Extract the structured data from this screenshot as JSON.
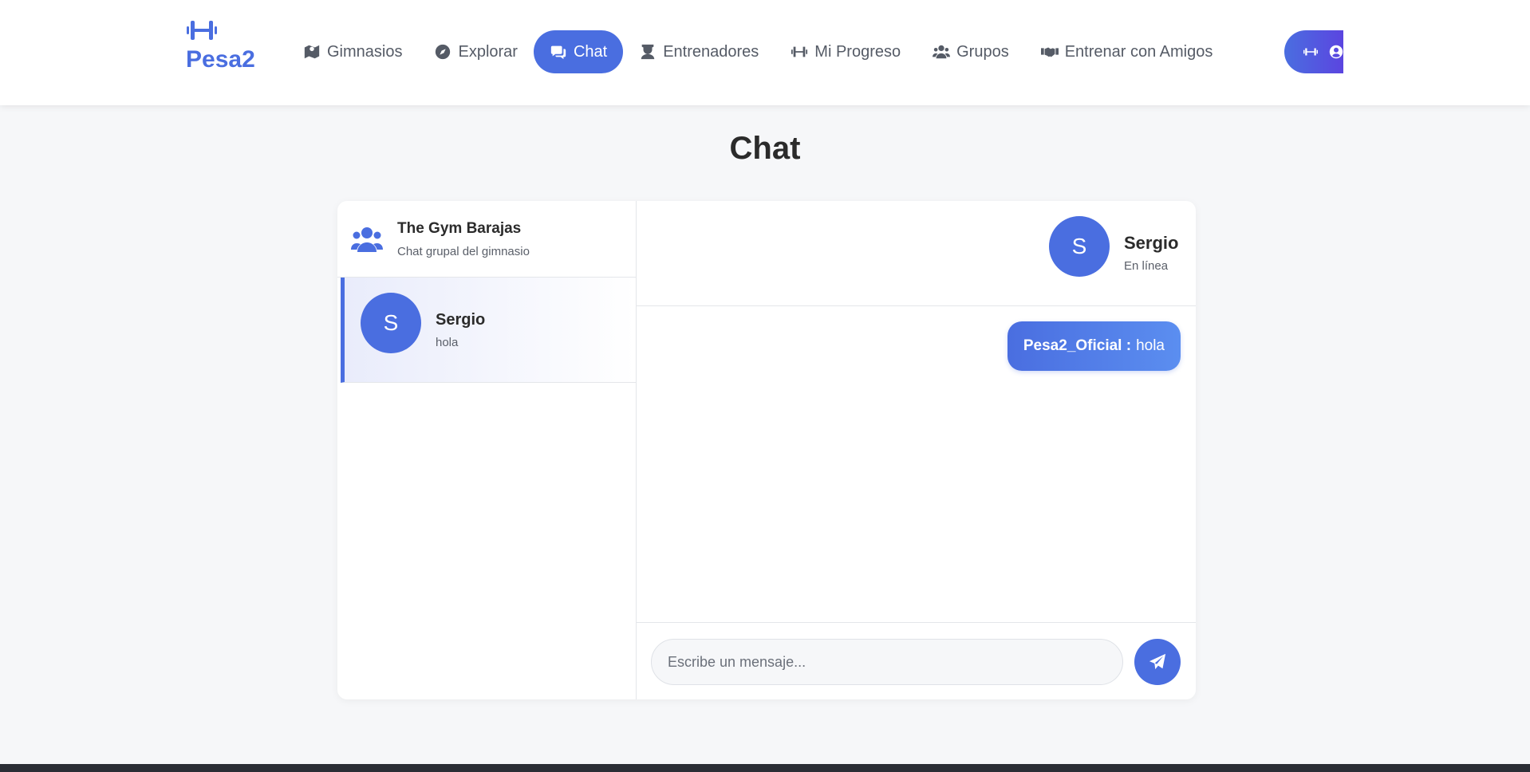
{
  "brand": {
    "name": "Pesa2",
    "icon": "dumbbell-icon",
    "color": "#4a6ee0"
  },
  "nav": {
    "items": [
      {
        "label": "Gimnasios",
        "icon": "map-icon"
      },
      {
        "label": "Explorar",
        "icon": "compass-icon"
      },
      {
        "label": "Chat",
        "icon": "comments-icon",
        "active": true
      },
      {
        "label": "Entrenadores",
        "icon": "trainer-icon"
      },
      {
        "label": "Mi Progreso",
        "icon": "dumbbell-icon"
      },
      {
        "label": "Grupos",
        "icon": "users-icon"
      },
      {
        "label": "Entrenar con Amigos",
        "icon": "handshake-icon"
      }
    ],
    "user_menu_icons": [
      "dumbbell-icon",
      "user-circle-icon"
    ]
  },
  "page": {
    "title": "Chat"
  },
  "sidebar": {
    "group": {
      "title": "The Gym Barajas",
      "subtitle": "Chat grupal del gimnasio",
      "icon": "users-icon"
    },
    "contacts": [
      {
        "initial": "S",
        "name": "Sergio",
        "last_message": "hola",
        "selected": true
      }
    ]
  },
  "conversation": {
    "header": {
      "initial": "S",
      "name": "Sergio",
      "status": "En línea"
    },
    "messages": [
      {
        "sender": "Pesa2_Oficial :",
        "text": "hola",
        "outgoing": true
      }
    ],
    "composer": {
      "placeholder": "Escribe un mensaje...",
      "value": "",
      "send_icon": "paper-plane-icon"
    }
  },
  "colors": {
    "accent": "#4a6ee0",
    "background": "#f6f7f9",
    "footer": "#2a2d35"
  }
}
